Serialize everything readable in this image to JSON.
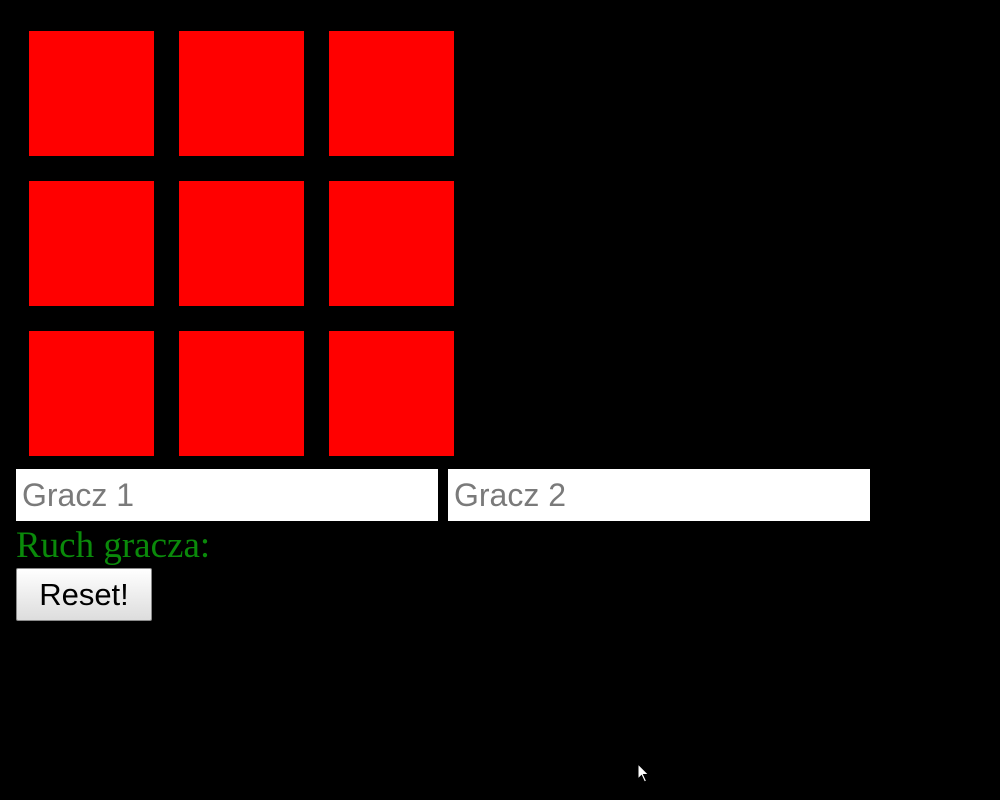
{
  "board": {
    "cells": [
      "",
      "",
      "",
      "",
      "",
      "",
      "",
      "",
      ""
    ],
    "cell_color": "#ff0000"
  },
  "players": {
    "player1_placeholder": "Gracz 1",
    "player2_placeholder": "Gracz 2",
    "player1_value": "",
    "player2_value": ""
  },
  "status": {
    "turn_label": "Ruch gracza:",
    "color": "#0a8a0a"
  },
  "controls": {
    "reset_label": "Reset!"
  },
  "background_color": "#000000"
}
